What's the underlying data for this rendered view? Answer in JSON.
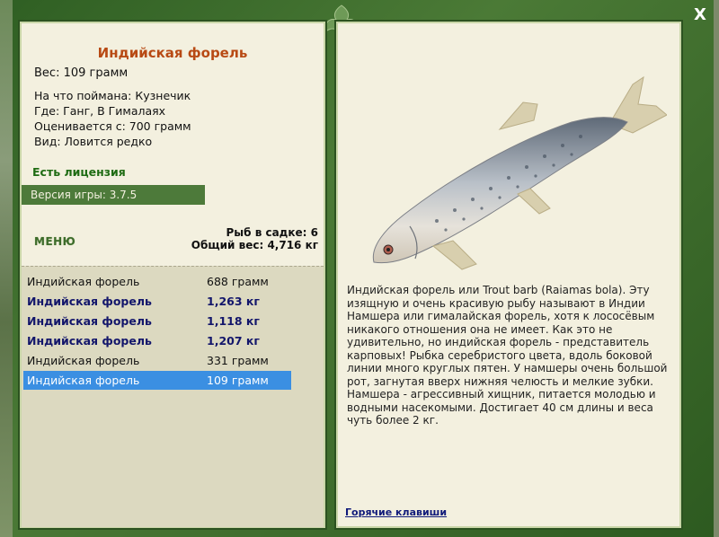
{
  "fish": {
    "title": "Индийская форель",
    "weight": "Вес: 109 грамм",
    "caught_with": "На что поймана: Кузнечик",
    "location": "Где: Ганг, В Гималаях",
    "valued_from": "Оценивается с: 700 грамм",
    "rarity": "Вид: Ловится редко"
  },
  "license": "Есть лицензия",
  "version": "Версия игры: 3.7.5",
  "menu_label": "МЕНЮ",
  "totals": {
    "fish_count": "Рыб в садке: 6",
    "total_weight": "Общий вес: 4,716 кг"
  },
  "catch_list": [
    {
      "name": "Индийская форель",
      "weight": "688 грамм",
      "style": "normal"
    },
    {
      "name": "Индийская форель",
      "weight": "1,263 кг",
      "style": "heavy"
    },
    {
      "name": "Индийская форель",
      "weight": "1,118 кг",
      "style": "heavy"
    },
    {
      "name": "Индийская форель",
      "weight": "1,207 кг",
      "style": "heavy"
    },
    {
      "name": "Индийская форель",
      "weight": "331 грамм",
      "style": "normal"
    },
    {
      "name": "Индийская форель",
      "weight": "109 грамм",
      "style": "selected"
    }
  ],
  "description": "Индийская форель или Trout barb (Raiamas bola). Эту изящную и очень красивую рыбу называют в Индии Намшера или гималайская форель, хотя к лососёвым никакого отношения она не имеет. Как это не удивительно, но индийская форель - представитель карповых! Рыбка серебристого цвета, вдоль боковой линии много круглых пятен. У намшеры очень большой рот, загнутая вверх нижняя челюсть и мелкие зубки. Намшера - агрессивный хищник, питается молодью и водными насекомыми. Достигает 40 см длины и веса чуть более 2 кг.",
  "hotkeys_label": "Горячие клавиши",
  "close_label": "X",
  "colors": {
    "frame": "#3d6b2a",
    "panel": "#f3f0df",
    "title": "#b84a14",
    "heavy": "#13166b",
    "selected": "#3b8fe2"
  }
}
